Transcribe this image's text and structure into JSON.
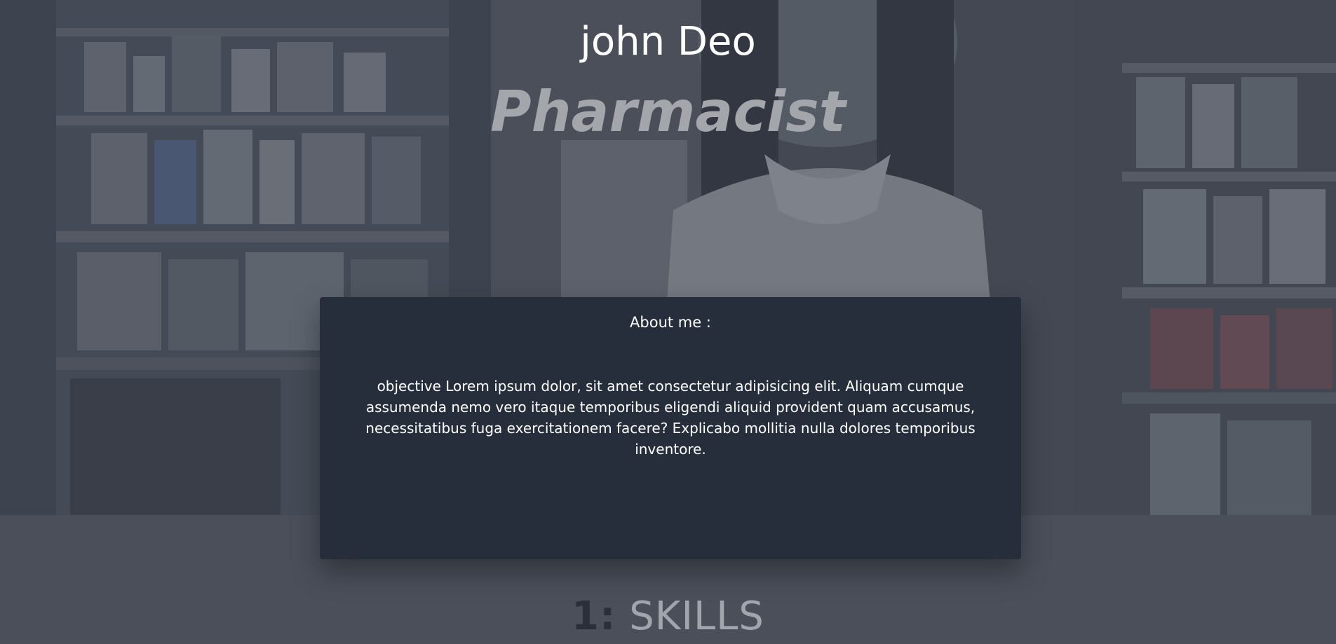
{
  "hero": {
    "name": "john Deo",
    "title": "Pharmacist",
    "background_icon": "pharmacy-photo"
  },
  "about": {
    "heading": "About me :",
    "text": "objective Lorem ipsum dolor, sit amet consectetur adipisicing elit. Aliquam cumque assumenda nemo vero itaque temporibus eligendi aliquid provident quam accusamus, necessitatibus fuga exercitationem facere? Explicabo mollitia nulla dolores temporibus inventore."
  },
  "skills": {
    "number": "1:",
    "label": "SKILLS"
  },
  "colors": {
    "page_bg": "#4a4f5a",
    "card_bg": "#272e3b",
    "title_gray": "#a3a6ab",
    "skills_number": "#2a2f3a"
  }
}
